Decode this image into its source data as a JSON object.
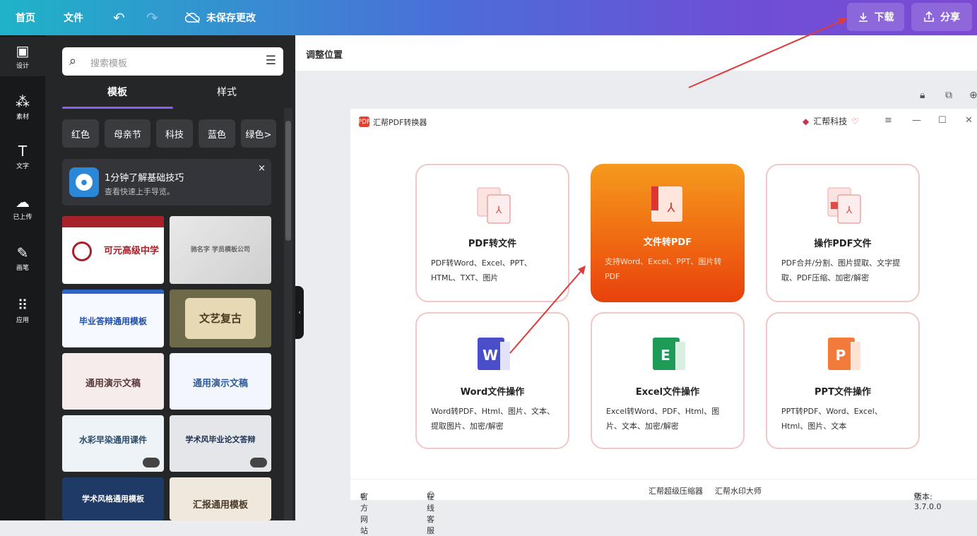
{
  "topbar": {
    "home": "首页",
    "file": "文件",
    "undo_icon": "undo-icon",
    "redo_icon": "redo-icon",
    "save_status": "未保存更改",
    "download": "下载",
    "share": "分享",
    "colors": {
      "start": "#1fb3c8",
      "end": "#7c4ad3"
    }
  },
  "rail": {
    "items": [
      {
        "label": "设计",
        "icon": "layout-icon"
      },
      {
        "label": "素材",
        "icon": "elements-icon"
      },
      {
        "label": "文字",
        "icon": "text-icon"
      },
      {
        "label": "已上传",
        "icon": "cloud-upload-icon"
      },
      {
        "label": "画笔",
        "icon": "brush-icon"
      },
      {
        "label": "应用",
        "icon": "apps-grid-icon"
      }
    ]
  },
  "panel": {
    "search_placeholder": "搜索模板",
    "tabs": [
      "模板",
      "样式"
    ],
    "chips": [
      "红色",
      "母亲节",
      "科技",
      "蓝色",
      "绿色>"
    ],
    "tip": {
      "title": "1分钟了解基础技巧",
      "subtitle": "查看快速上手导览。",
      "close": "×"
    },
    "thumbs": [
      {
        "text": "可元高级中学"
      },
      {
        "text": "驰名字 学员模板公司"
      },
      {
        "text": "毕业答辩通用模板"
      },
      {
        "text": "文艺复古"
      },
      {
        "text": "通用演示文稿"
      },
      {
        "text": "通用演示文稿"
      },
      {
        "text": "水彩早染通用课件"
      },
      {
        "text": "学术风毕业论文答辩"
      },
      {
        "text": "学术风格通用模板"
      },
      {
        "text": "汇报通用模板"
      }
    ]
  },
  "canvas": {
    "title": "调整位置"
  },
  "app": {
    "name": "汇帮PDF转换器",
    "logo_text": "PDF",
    "brand": "汇帮科技",
    "window_controls": [
      "≡",
      "—",
      "☐",
      "✕"
    ],
    "cards": [
      {
        "title": "PDF转文件",
        "desc": "PDF转Word、Excel、PPT、HTML、TXT、图片",
        "icon": "pdf-to-file-icon"
      },
      {
        "title": "文件转PDF",
        "desc": "支持Word、Excel、PPT、图片转PDF",
        "icon": "file-to-pdf-icon"
      },
      {
        "title": "操作PDF文件",
        "desc": "PDF合并/分割、图片提取、文字提取、PDF压缩、加密/解密",
        "icon": "pdf-operations-icon"
      },
      {
        "title": "Word文件操作",
        "desc": "Word转PDF、Html、图片、文本、提取图片、加密/解密",
        "icon": "word-icon"
      },
      {
        "title": "Excel文件操作",
        "desc": "Excel转Word、PDF、Html、图片、文本、加密/解密",
        "icon": "excel-icon"
      },
      {
        "title": "PPT文件操作",
        "desc": "PPT转PDF、Word、Excel、Html、图片、文本",
        "icon": "ppt-icon"
      }
    ],
    "footer": {
      "website": "官方网站",
      "support": "在线客服",
      "link1": "汇帮超级压缩器",
      "link2": "汇帮水印大师",
      "version": "版本: 3.7.0.0"
    }
  }
}
